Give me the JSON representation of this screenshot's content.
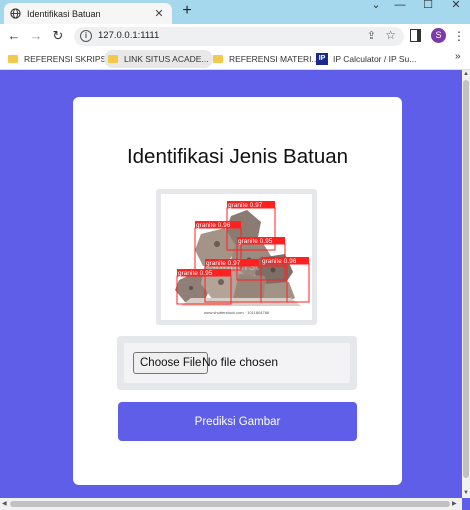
{
  "browser": {
    "tab_title": "Identifikasi Batuan",
    "url": "127.0.0.1:1111",
    "profile_initial": "S",
    "bookmarks": [
      {
        "label": "REFERENSI SKRIPSI",
        "icon": "folder-icon"
      },
      {
        "label": "LINK SITUS ACADE...",
        "icon": "folder-icon"
      },
      {
        "label": "REFERENSI MATERI...",
        "icon": "folder-icon"
      },
      {
        "label": "IP Calculator / IP Su...",
        "icon": "ip-calculator-icon",
        "badge": "IP"
      }
    ]
  },
  "page": {
    "title": "Identifikasi Jenis Batuan",
    "image": {
      "watermark": "www.shutterstock.com · 1011804766",
      "detections": [
        {
          "label": "granite 0.97"
        },
        {
          "label": "granite 0.96"
        },
        {
          "label": "granite 0.95"
        },
        {
          "label": "granite 0.97"
        },
        {
          "label": "granite 0.96"
        },
        {
          "label": "granite 0.95"
        }
      ]
    },
    "file_input": {
      "button_label": "Choose File",
      "status": "No file chosen"
    },
    "predict_button": "Prediksi Gambar"
  },
  "colors": {
    "accent": "#5f5ee9",
    "tabbar": "#a5d8ed",
    "detection_box": "#ff2020"
  }
}
